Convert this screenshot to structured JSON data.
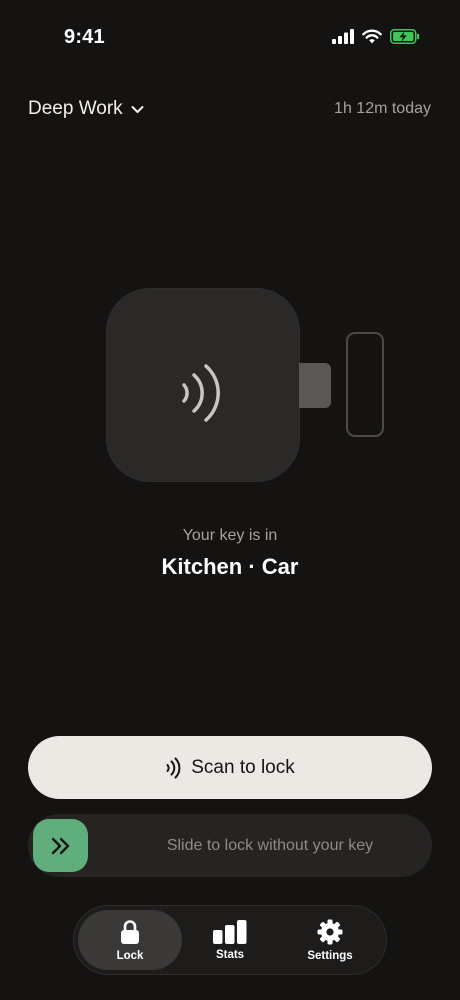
{
  "status_bar": {
    "time": "9:41",
    "icons": [
      "cellular-signal-icon",
      "wifi-icon",
      "battery-charging-icon"
    ],
    "battery_color": "#3ec65a"
  },
  "header": {
    "mode": "Deep Work",
    "mode_icon": "chevron-down-icon",
    "today_time": "1h 12m today"
  },
  "device": {
    "icon": "nfc-waves-icon"
  },
  "key": {
    "caption": "Your key is in",
    "location": "Kitchen · Car"
  },
  "scan_button": {
    "label": "Scan to lock",
    "icon": "nfc-waves-icon"
  },
  "slider": {
    "label": "Slide to lock without your key",
    "icon": "double-chevron-right-icon",
    "accent": "#5fae7c"
  },
  "tabs": [
    {
      "label": "Lock",
      "icon": "lock-icon",
      "active": true
    },
    {
      "label": "Stats",
      "icon": "bar-chart-icon",
      "active": false
    },
    {
      "label": "Settings",
      "icon": "gear-icon",
      "active": false
    }
  ]
}
